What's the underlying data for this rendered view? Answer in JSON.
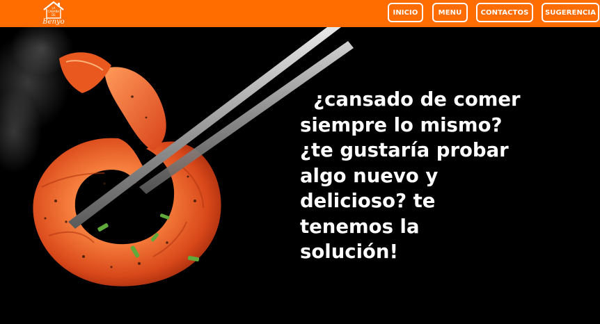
{
  "navbar": {
    "logo": {
      "line1": "LA",
      "line2": "CABAÑA",
      "line3": "DE",
      "script": "Benyo"
    },
    "buttons": [
      {
        "label": "INICIO"
      },
      {
        "label": "MENU"
      },
      {
        "label": "CONTACTOS"
      },
      {
        "label": "SUGERENCIA"
      }
    ],
    "accent_color": "#ff6c00"
  },
  "hero": {
    "headline_lines": [
      "  ¿cansado de comer",
      "siempre lo mismo?",
      "¿te gustaría probar",
      "algo nuevo y",
      "delicioso? te",
      "tenemos la",
      "solución!"
    ],
    "image": "shrimp-with-chopsticks"
  }
}
